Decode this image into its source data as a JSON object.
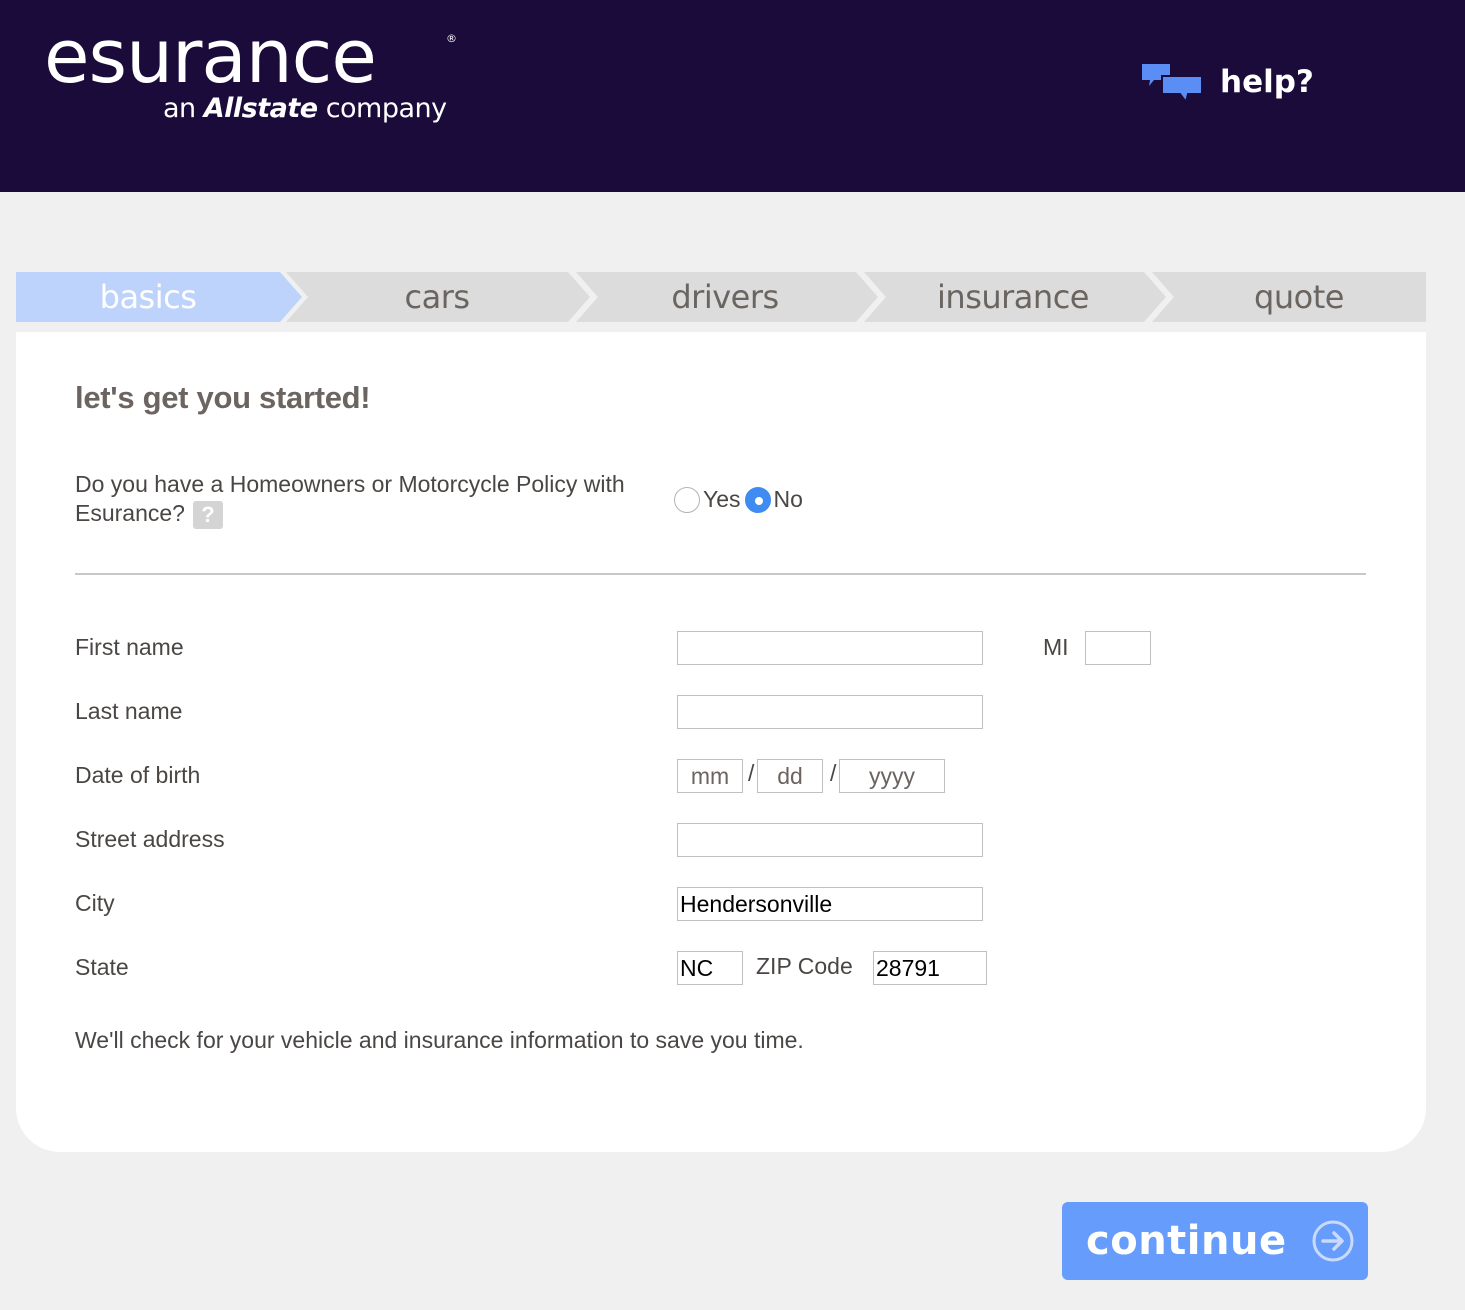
{
  "header": {
    "logo_text": "esurance",
    "logo_registered": "®",
    "logo_sub_prefix": "an",
    "logo_sub_brand": "Allstate",
    "logo_sub_suffix": "company",
    "help_label": "help?",
    "help_icon": "chat-bubbles-icon"
  },
  "colors": {
    "header_bg": "#1a0b3b",
    "accent": "#669cfb",
    "step_active": "#bdd3fb",
    "step_inactive": "#dcdcdc",
    "radio_checked": "#3f8bf1"
  },
  "steps": [
    {
      "label": "basics",
      "active": true
    },
    {
      "label": "cars",
      "active": false
    },
    {
      "label": "drivers",
      "active": false
    },
    {
      "label": "insurance",
      "active": false
    },
    {
      "label": "quote",
      "active": false
    }
  ],
  "form": {
    "heading": "let's get you started!",
    "question": {
      "text": "Do you have a Homeowners or Motorcycle Policy with Esurance?",
      "help_icon_text": "?",
      "options": [
        {
          "label": "Yes",
          "checked": false
        },
        {
          "label": "No",
          "checked": true
        }
      ]
    },
    "first_name": {
      "label": "First name",
      "value": ""
    },
    "mi": {
      "label": "MI",
      "value": ""
    },
    "last_name": {
      "label": "Last name",
      "value": ""
    },
    "dob": {
      "label": "Date of birth",
      "separator": "/",
      "mm_placeholder": "mm",
      "dd_placeholder": "dd",
      "yyyy_placeholder": "yyyy"
    },
    "street": {
      "label": "Street address",
      "value": ""
    },
    "city": {
      "label": "City",
      "value": "Hendersonville"
    },
    "state": {
      "label": "State",
      "value": "NC"
    },
    "zip": {
      "label": "ZIP Code",
      "value": "28791"
    },
    "note": "We'll check for your vehicle and insurance information to save you time."
  },
  "actions": {
    "continue_label": "continue",
    "continue_icon": "arrow-right-circle-icon"
  }
}
